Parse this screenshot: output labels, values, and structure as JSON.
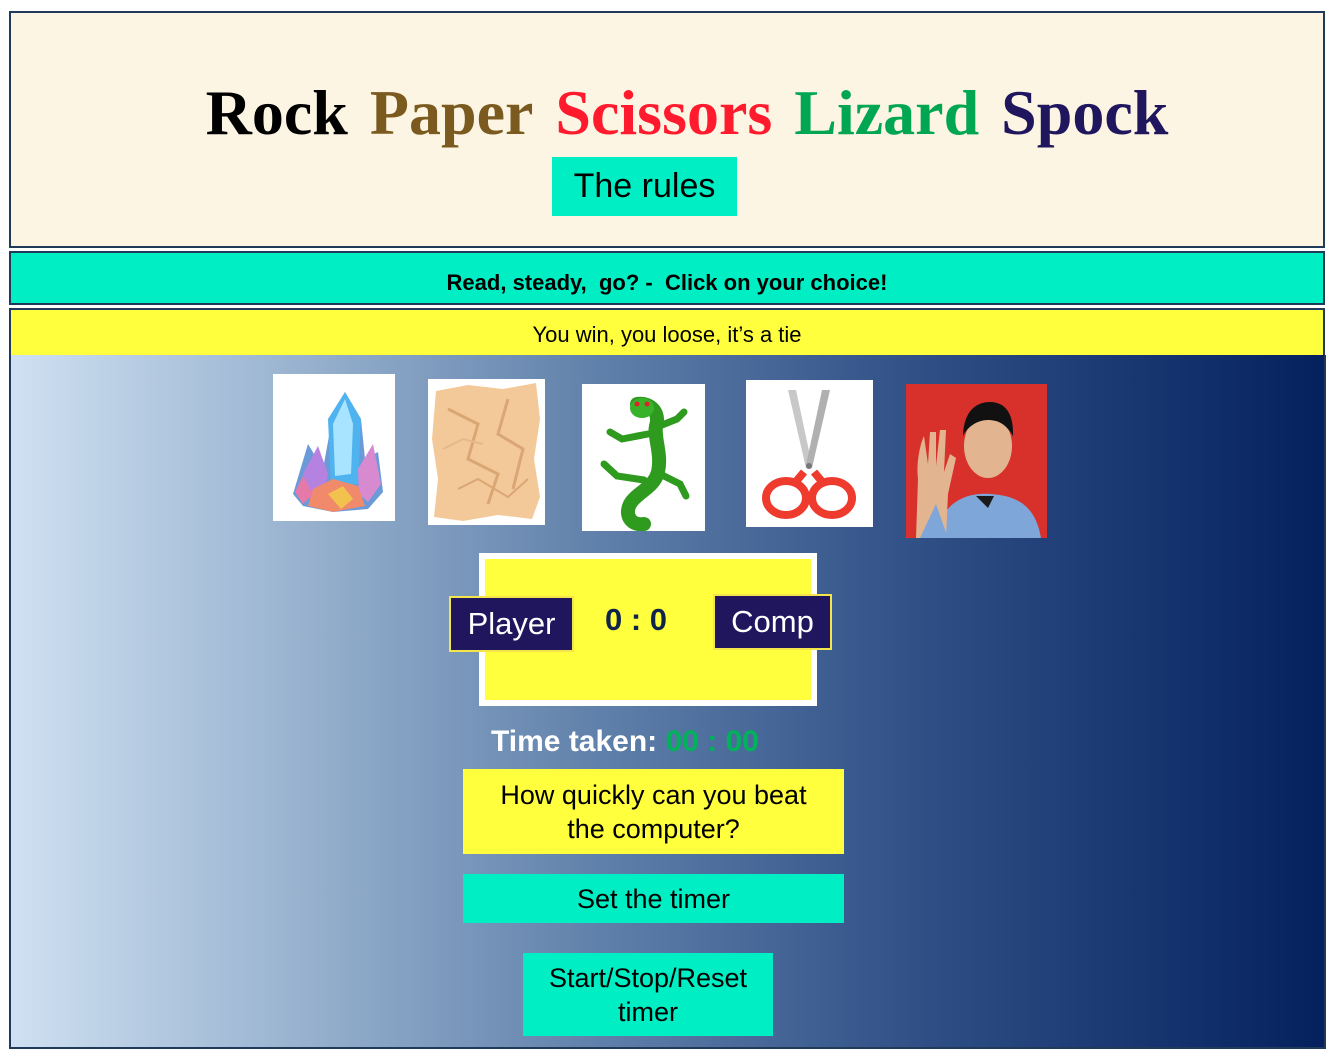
{
  "header": {
    "title_words": [
      {
        "text": "Rock",
        "color": "#000000"
      },
      {
        "text": "Paper",
        "color": "#7a5a1e"
      },
      {
        "text": "Scissors",
        "color": "#ff1a2e"
      },
      {
        "text": "Lizard",
        "color": "#00a651"
      },
      {
        "text": "Spock",
        "color": "#20165e"
      }
    ],
    "rules_button": "The rules"
  },
  "status": {
    "prompt": "Read, steady,  go? -  Click on your choice!",
    "result": "You win, you loose, it’s a tie"
  },
  "choices": [
    {
      "name": "rock",
      "icon": "crystal-rock-image"
    },
    {
      "name": "paper",
      "icon": "crumpled-paper-image"
    },
    {
      "name": "lizard",
      "icon": "green-lizard-image"
    },
    {
      "name": "scissors",
      "icon": "red-scissors-image"
    },
    {
      "name": "spock",
      "icon": "spock-salute-image"
    }
  ],
  "scoreboard": {
    "player_label": "Player",
    "comp_label": "Comp",
    "score": "0 : 0"
  },
  "timer": {
    "label": "Time taken:",
    "value": "00 : 00",
    "challenge": "How quickly can you beat the computer?",
    "set_button": "Set the timer",
    "control_button": "Start/Stop/Reset timer"
  },
  "colors": {
    "accent_teal": "#00eec4",
    "accent_yellow": "#ffff3d",
    "navy": "#20165e",
    "timer_green": "#00b25a"
  }
}
